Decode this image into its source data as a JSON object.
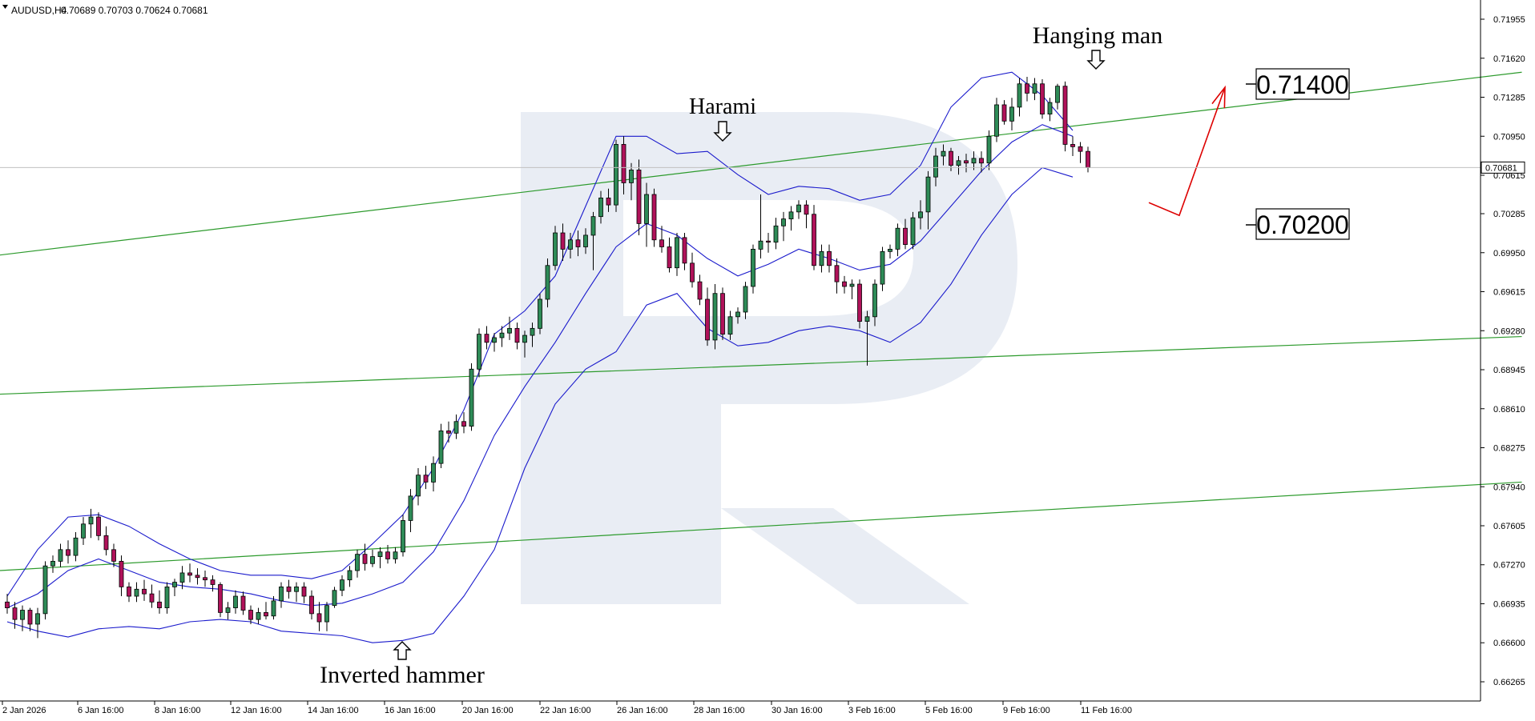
{
  "header": {
    "menu_icon": "triangle-down-icon",
    "symbol": "AUDUSD,H4",
    "ohlc": "0.70689 0.70703 0.70624 0.70681"
  },
  "price_label": "0.70681",
  "annotations": {
    "harami": "Harami",
    "hanging_man": "Hanging man",
    "inverted_hammer": "Inverted hammer",
    "arrow_icon": "hollow-arrow-icon"
  },
  "levels": {
    "upper_target": "0.71400",
    "lower_target": "0.70200"
  },
  "colors": {
    "bull": "#2e8b57",
    "bear": "#b0125a",
    "bands": "#1a1acc",
    "channel": "#2c9a2c",
    "forecast": "#dd0000",
    "watermark": "#e9edf4"
  },
  "chart_data": {
    "type": "candlestick",
    "symbol": "AUDUSD",
    "timeframe": "H4",
    "ylim": [
      0.661,
      0.7212
    ],
    "y_ticks": [
      "0.71955",
      "0.71620",
      "0.71285",
      "0.70950",
      "0.70615",
      "0.70285",
      "0.69950",
      "0.69615",
      "0.69280",
      "0.68945",
      "0.68610",
      "0.68275",
      "0.67940",
      "0.67605",
      "0.67270",
      "0.66935",
      "0.66600",
      "0.66265"
    ],
    "x_ticks": [
      "2 Jan 2026",
      "6 Jan 16:00",
      "8 Jan 16:00",
      "12 Jan 16:00",
      "14 Jan 16:00",
      "16 Jan 16:00",
      "20 Jan 16:00",
      "22 Jan 16:00",
      "26 Jan 16:00",
      "28 Jan 16:00",
      "30 Jan 16:00",
      "3 Feb 16:00",
      "5 Feb 16:00",
      "9 Feb 16:00",
      "11 Feb 16:00"
    ],
    "current_price": 0.70681,
    "candles": [
      [
        0.6695,
        0.6702,
        0.6685,
        0.669
      ],
      [
        0.669,
        0.6695,
        0.6672,
        0.668
      ],
      [
        0.668,
        0.6692,
        0.667,
        0.6688
      ],
      [
        0.6688,
        0.669,
        0.667,
        0.6676
      ],
      [
        0.6676,
        0.669,
        0.6664,
        0.6685
      ],
      [
        0.6685,
        0.673,
        0.668,
        0.6726
      ],
      [
        0.6726,
        0.6735,
        0.672,
        0.673
      ],
      [
        0.673,
        0.6745,
        0.6725,
        0.674
      ],
      [
        0.674,
        0.6748,
        0.6728,
        0.6735
      ],
      [
        0.6735,
        0.6755,
        0.673,
        0.675
      ],
      [
        0.675,
        0.6768,
        0.6744,
        0.6762
      ],
      [
        0.6762,
        0.6775,
        0.675,
        0.6768
      ],
      [
        0.6768,
        0.6772,
        0.6748,
        0.6752
      ],
      [
        0.6752,
        0.676,
        0.6735,
        0.674
      ],
      [
        0.674,
        0.6745,
        0.6725,
        0.673
      ],
      [
        0.673,
        0.6735,
        0.67,
        0.6708
      ],
      [
        0.6708,
        0.6712,
        0.6695,
        0.67
      ],
      [
        0.67,
        0.6712,
        0.6695,
        0.6706
      ],
      [
        0.6706,
        0.6714,
        0.6696,
        0.6702
      ],
      [
        0.6702,
        0.671,
        0.669,
        0.6695
      ],
      [
        0.6695,
        0.6705,
        0.6685,
        0.669
      ],
      [
        0.669,
        0.6712,
        0.6685,
        0.6708
      ],
      [
        0.6708,
        0.6715,
        0.67,
        0.6712
      ],
      [
        0.6712,
        0.6726,
        0.6706,
        0.672
      ],
      [
        0.672,
        0.6728,
        0.6712,
        0.6718
      ],
      [
        0.6718,
        0.6724,
        0.671,
        0.6716
      ],
      [
        0.6716,
        0.6722,
        0.6708,
        0.6714
      ],
      [
        0.6714,
        0.6718,
        0.6704,
        0.671
      ],
      [
        0.671,
        0.6712,
        0.6682,
        0.6686
      ],
      [
        0.6686,
        0.6695,
        0.668,
        0.669
      ],
      [
        0.669,
        0.6705,
        0.6685,
        0.67
      ],
      [
        0.67,
        0.6704,
        0.6684,
        0.6688
      ],
      [
        0.6688,
        0.6692,
        0.6676,
        0.668
      ],
      [
        0.668,
        0.669,
        0.6676,
        0.6686
      ],
      [
        0.6686,
        0.6695,
        0.668,
        0.6683
      ],
      [
        0.6683,
        0.67,
        0.668,
        0.6696
      ],
      [
        0.6696,
        0.6712,
        0.669,
        0.6708
      ],
      [
        0.6708,
        0.6714,
        0.6698,
        0.6704
      ],
      [
        0.6704,
        0.6712,
        0.6695,
        0.6708
      ],
      [
        0.6708,
        0.6712,
        0.6694,
        0.67
      ],
      [
        0.67,
        0.6705,
        0.668,
        0.6685
      ],
      [
        0.6685,
        0.6695,
        0.667,
        0.6678
      ],
      [
        0.6678,
        0.6695,
        0.667,
        0.6692
      ],
      [
        0.6692,
        0.6708,
        0.669,
        0.6705
      ],
      [
        0.6705,
        0.6718,
        0.67,
        0.6714
      ],
      [
        0.6714,
        0.6726,
        0.6708,
        0.6722
      ],
      [
        0.6722,
        0.674,
        0.6716,
        0.6736
      ],
      [
        0.6736,
        0.6745,
        0.6722,
        0.6728
      ],
      [
        0.6728,
        0.674,
        0.6725,
        0.6734
      ],
      [
        0.6734,
        0.6742,
        0.6724,
        0.6738
      ],
      [
        0.6738,
        0.6744,
        0.6728,
        0.6732
      ],
      [
        0.6732,
        0.6742,
        0.6728,
        0.6738
      ],
      [
        0.6738,
        0.677,
        0.6734,
        0.6765
      ],
      [
        0.6765,
        0.6792,
        0.6755,
        0.6786
      ],
      [
        0.6786,
        0.681,
        0.6778,
        0.6804
      ],
      [
        0.6804,
        0.6812,
        0.6792,
        0.6798
      ],
      [
        0.6798,
        0.682,
        0.679,
        0.6814
      ],
      [
        0.6814,
        0.6848,
        0.681,
        0.6842
      ],
      [
        0.6842,
        0.685,
        0.6832,
        0.684
      ],
      [
        0.684,
        0.6856,
        0.6835,
        0.685
      ],
      [
        0.685,
        0.6858,
        0.684,
        0.6846
      ],
      [
        0.6846,
        0.69,
        0.6842,
        0.6895
      ],
      [
        0.6895,
        0.693,
        0.6888,
        0.6925
      ],
      [
        0.6925,
        0.6932,
        0.6912,
        0.6918
      ],
      [
        0.6918,
        0.6926,
        0.691,
        0.6922
      ],
      [
        0.6922,
        0.6932,
        0.6914,
        0.6926
      ],
      [
        0.6926,
        0.694,
        0.692,
        0.693
      ],
      [
        0.693,
        0.6935,
        0.6912,
        0.6918
      ],
      [
        0.6918,
        0.6928,
        0.6905,
        0.6924
      ],
      [
        0.6924,
        0.6935,
        0.6914,
        0.693
      ],
      [
        0.693,
        0.696,
        0.6925,
        0.6955
      ],
      [
        0.6955,
        0.699,
        0.6948,
        0.6984
      ],
      [
        0.6984,
        0.7018,
        0.698,
        0.7012
      ],
      [
        0.7012,
        0.702,
        0.6988,
        0.6998
      ],
      [
        0.6998,
        0.7012,
        0.699,
        0.7006
      ],
      [
        0.7006,
        0.7014,
        0.6992,
        0.7
      ],
      [
        0.7,
        0.7016,
        0.6994,
        0.701
      ],
      [
        0.701,
        0.703,
        0.698,
        0.7026
      ],
      [
        0.7026,
        0.7048,
        0.702,
        0.7042
      ],
      [
        0.7042,
        0.705,
        0.703,
        0.7036
      ],
      [
        0.7036,
        0.7092,
        0.703,
        0.7088
      ],
      [
        0.7088,
        0.7095,
        0.7045,
        0.7055
      ],
      [
        0.7055,
        0.7072,
        0.704,
        0.7066
      ],
      [
        0.7066,
        0.7075,
        0.701,
        0.702
      ],
      [
        0.702,
        0.7055,
        0.7,
        0.7045
      ],
      [
        0.7045,
        0.705,
        0.7,
        0.7006
      ],
      [
        0.7006,
        0.7018,
        0.6995,
        0.7
      ],
      [
        0.7,
        0.7008,
        0.6978,
        0.6982
      ],
      [
        0.6982,
        0.7012,
        0.6975,
        0.7008
      ],
      [
        0.7008,
        0.7012,
        0.698,
        0.6986
      ],
      [
        0.6986,
        0.6995,
        0.6965,
        0.697
      ],
      [
        0.697,
        0.6976,
        0.695,
        0.6955
      ],
      [
        0.6955,
        0.6965,
        0.6915,
        0.692
      ],
      [
        0.692,
        0.6968,
        0.6912,
        0.696
      ],
      [
        0.696,
        0.6965,
        0.692,
        0.6925
      ],
      [
        0.6925,
        0.6945,
        0.692,
        0.694
      ],
      [
        0.694,
        0.6948,
        0.6934,
        0.6944
      ],
      [
        0.6944,
        0.697,
        0.6938,
        0.6966
      ],
      [
        0.6966,
        0.7002,
        0.696,
        0.6998
      ],
      [
        0.6998,
        0.7045,
        0.699,
        0.7005
      ],
      [
        0.7005,
        0.7012,
        0.6995,
        0.7004
      ],
      [
        0.7004,
        0.7025,
        0.6998,
        0.7018
      ],
      [
        0.7018,
        0.703,
        0.7005,
        0.7024
      ],
      [
        0.7024,
        0.7035,
        0.7014,
        0.703
      ],
      [
        0.703,
        0.704,
        0.7024,
        0.7036
      ],
      [
        0.7036,
        0.704,
        0.7016,
        0.7028
      ],
      [
        0.7028,
        0.7036,
        0.698,
        0.6984
      ],
      [
        0.6984,
        0.7002,
        0.6978,
        0.6996
      ],
      [
        0.6996,
        0.7002,
        0.6978,
        0.6984
      ],
      [
        0.6984,
        0.699,
        0.696,
        0.697
      ],
      [
        0.697,
        0.6975,
        0.696,
        0.6966
      ],
      [
        0.6966,
        0.6972,
        0.6955,
        0.6968
      ],
      [
        0.6968,
        0.6972,
        0.693,
        0.6936
      ],
      [
        0.6936,
        0.6945,
        0.6898,
        0.694
      ],
      [
        0.694,
        0.6972,
        0.6932,
        0.6968
      ],
      [
        0.6968,
        0.7,
        0.6962,
        0.6996
      ],
      [
        0.6996,
        0.7002,
        0.699,
        0.6998
      ],
      [
        0.6998,
        0.702,
        0.6992,
        0.7016
      ],
      [
        0.7016,
        0.7024,
        0.6998,
        0.7002
      ],
      [
        0.7002,
        0.703,
        0.6998,
        0.7025
      ],
      [
        0.7025,
        0.704,
        0.7015,
        0.703
      ],
      [
        0.703,
        0.7065,
        0.7015,
        0.706
      ],
      [
        0.706,
        0.7085,
        0.7052,
        0.7078
      ],
      [
        0.7078,
        0.7088,
        0.707,
        0.7082
      ],
      [
        0.7082,
        0.7085,
        0.7065,
        0.707
      ],
      [
        0.707,
        0.7078,
        0.7062,
        0.7074
      ],
      [
        0.7074,
        0.708,
        0.7064,
        0.7072
      ],
      [
        0.7072,
        0.7082,
        0.7066,
        0.7076
      ],
      [
        0.7076,
        0.7082,
        0.7064,
        0.7072
      ],
      [
        0.7072,
        0.71,
        0.7066,
        0.7095
      ],
      [
        0.7095,
        0.7128,
        0.709,
        0.7122
      ],
      [
        0.7122,
        0.7126,
        0.7105,
        0.7108
      ],
      [
        0.7108,
        0.7128,
        0.71,
        0.712
      ],
      [
        0.712,
        0.7145,
        0.7112,
        0.714
      ],
      [
        0.714,
        0.7146,
        0.7125,
        0.7132
      ],
      [
        0.7132,
        0.7145,
        0.7126,
        0.714
      ],
      [
        0.714,
        0.7144,
        0.711,
        0.7114
      ],
      [
        0.7114,
        0.7128,
        0.7108,
        0.7124
      ],
      [
        0.7124,
        0.714,
        0.7118,
        0.7138
      ],
      [
        0.7138,
        0.7142,
        0.7082,
        0.7088
      ],
      [
        0.7088,
        0.7095,
        0.7078,
        0.7086
      ],
      [
        0.7086,
        0.709,
        0.7072,
        0.7082
      ],
      [
        0.7082,
        0.7086,
        0.7064,
        0.7068
      ]
    ],
    "bollinger": {
      "x_index": [
        0,
        4,
        8,
        12,
        16,
        20,
        24,
        28,
        32,
        36,
        40,
        44,
        48,
        52,
        56,
        60,
        64,
        68,
        72,
        76,
        80,
        84,
        88,
        92,
        96,
        100,
        104,
        108,
        112,
        116,
        120,
        124,
        128,
        132,
        136,
        140
      ],
      "upper": [
        0.67,
        0.674,
        0.6768,
        0.677,
        0.676,
        0.6745,
        0.6732,
        0.6722,
        0.6718,
        0.6718,
        0.6715,
        0.6722,
        0.6745,
        0.677,
        0.681,
        0.686,
        0.6925,
        0.6945,
        0.6975,
        0.7035,
        0.7095,
        0.7095,
        0.708,
        0.7082,
        0.7062,
        0.7045,
        0.7052,
        0.705,
        0.704,
        0.7045,
        0.707,
        0.712,
        0.7145,
        0.715,
        0.713,
        0.71
      ],
      "mid": [
        0.669,
        0.6702,
        0.6722,
        0.6732,
        0.6722,
        0.6712,
        0.6708,
        0.6706,
        0.6702,
        0.6696,
        0.6692,
        0.6694,
        0.6702,
        0.6712,
        0.6738,
        0.6782,
        0.6838,
        0.688,
        0.6918,
        0.696,
        0.7,
        0.702,
        0.701,
        0.699,
        0.6975,
        0.6985,
        0.6998,
        0.699,
        0.698,
        0.6985,
        0.7005,
        0.7035,
        0.7065,
        0.709,
        0.7105,
        0.7095
      ],
      "lower": [
        0.6678,
        0.667,
        0.6665,
        0.6672,
        0.6674,
        0.6672,
        0.6678,
        0.668,
        0.6678,
        0.667,
        0.6668,
        0.6666,
        0.666,
        0.6662,
        0.6668,
        0.67,
        0.674,
        0.681,
        0.6865,
        0.6895,
        0.691,
        0.695,
        0.696,
        0.693,
        0.6915,
        0.6918,
        0.6928,
        0.6932,
        0.6928,
        0.6918,
        0.6935,
        0.6968,
        0.701,
        0.7045,
        0.7068,
        0.706
      ]
    },
    "channel_lines": [
      {
        "x_index": [
          0,
          199
        ],
        "y": [
          0.6993,
          0.715
        ]
      },
      {
        "x_index": [
          0,
          199
        ],
        "y": [
          0.68735,
          0.6923
        ]
      },
      {
        "x_index": [
          0,
          199
        ],
        "y": [
          0.6722,
          0.6798
        ]
      }
    ],
    "forecast_arrow": {
      "x_index": [
        150,
        154,
        160
      ],
      "y": [
        0.7038,
        0.7027,
        0.7137
      ]
    },
    "xlabel": "",
    "ylabel": ""
  }
}
